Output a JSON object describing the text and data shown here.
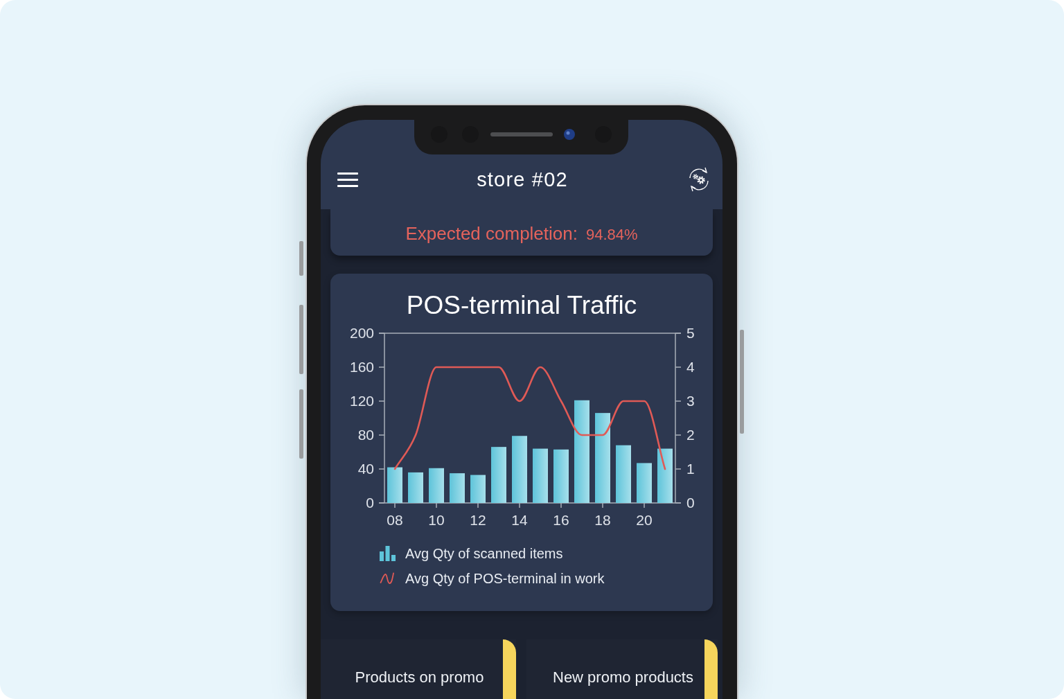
{
  "header": {
    "title": "store #02"
  },
  "completion": {
    "label": "Expected completion:",
    "value": "94.84%"
  },
  "chart_card": {
    "chart_data": {
      "type": "bar",
      "title": "POS-terminal Traffic",
      "x": [
        8,
        9,
        10,
        11,
        12,
        13,
        14,
        15,
        16,
        17,
        18,
        19,
        20,
        21
      ],
      "xlim": [
        7.5,
        21.5
      ],
      "xticks": [
        {
          "value": 8,
          "label": "08"
        },
        {
          "value": 10,
          "label": "10"
        },
        {
          "value": 12,
          "label": "12"
        },
        {
          "value": 14,
          "label": "14"
        },
        {
          "value": 16,
          "label": "16"
        },
        {
          "value": 18,
          "label": "18"
        },
        {
          "value": 20,
          "label": "20"
        }
      ],
      "ylim": [
        0,
        200
      ],
      "yticks": [
        0,
        40,
        80,
        120,
        160,
        200
      ],
      "y2lim": [
        0,
        5
      ],
      "y2ticks": [
        0,
        1,
        2,
        3,
        4,
        5
      ],
      "series": [
        {
          "name": "Avg Qty of scanned items",
          "color": "#5ec4da",
          "values": [
            42,
            36,
            41,
            35,
            33,
            66,
            79,
            64,
            63,
            121,
            106,
            68,
            47,
            64
          ]
        },
        {
          "name": "Avg Qty of POS-terminal in work",
          "type": "line",
          "axis": "y2",
          "color": "#e05a56",
          "values": [
            1,
            2,
            4,
            4,
            4,
            4,
            3,
            4,
            3,
            2,
            2,
            3,
            3,
            1
          ]
        }
      ]
    }
  },
  "stat_cards": [
    {
      "label": "Products on promo"
    },
    {
      "label": "New promo products"
    }
  ]
}
